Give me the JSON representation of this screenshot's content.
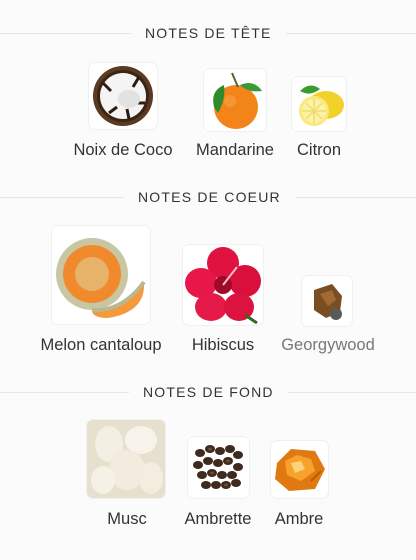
{
  "sections": [
    {
      "title": "NOTES DE TÊTE",
      "items": [
        {
          "label": "Noix de Coco",
          "icon": "coconut-icon"
        },
        {
          "label": "Mandarine",
          "icon": "mandarin-icon"
        },
        {
          "label": "Citron",
          "icon": "lemon-icon"
        }
      ]
    },
    {
      "title": "NOTES DE COEUR",
      "items": [
        {
          "label": "Melon cantaloup",
          "icon": "cantaloupe-icon"
        },
        {
          "label": "Hibiscus",
          "icon": "hibiscus-icon"
        },
        {
          "label": "Georgywood",
          "icon": "georgywood-icon"
        }
      ]
    },
    {
      "title": "NOTES DE FOND",
      "items": [
        {
          "label": "Musc",
          "icon": "musk-icon"
        },
        {
          "label": "Ambrette",
          "icon": "ambrette-seeds-icon"
        },
        {
          "label": "Ambre",
          "icon": "amber-icon"
        }
      ]
    }
  ]
}
